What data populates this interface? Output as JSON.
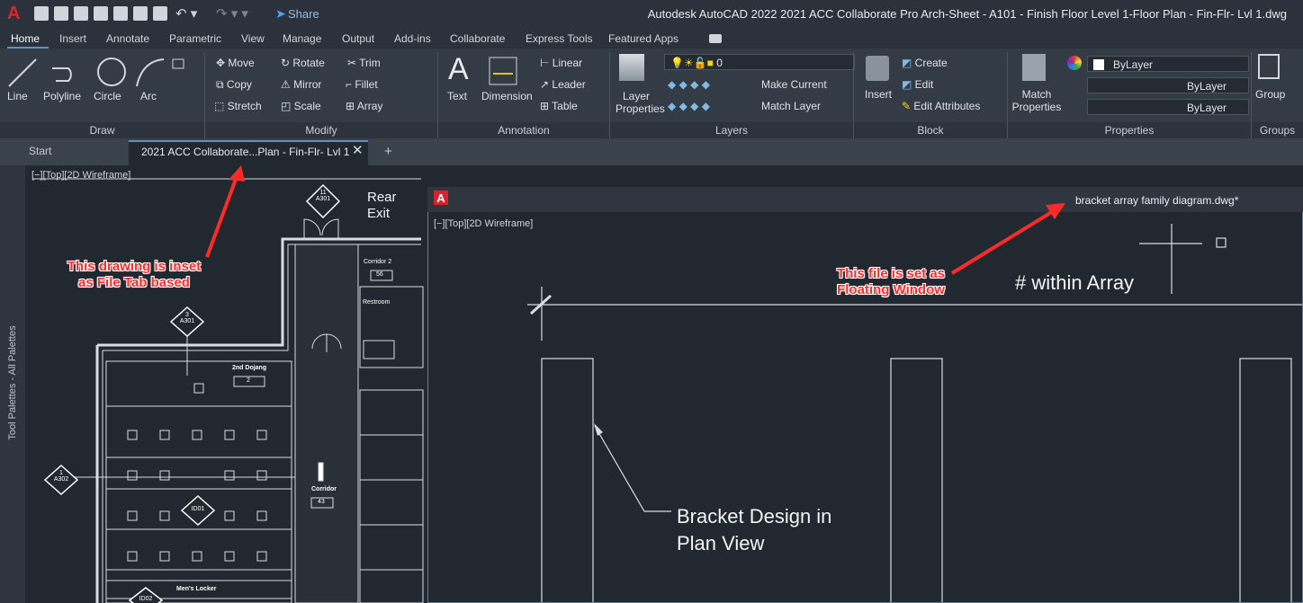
{
  "title_bar": {
    "app_logo": "A",
    "share_label": "Share",
    "title": "Autodesk AutoCAD 2022   2021 ACC Collaborate Pro Arch-Sheet - A101 - Finish Floor Level 1-Floor Plan - Fin-Flr- Lvl 1.dwg"
  },
  "ribbon_tabs": [
    "Home",
    "Insert",
    "Annotate",
    "Parametric",
    "View",
    "Manage",
    "Output",
    "Add-ins",
    "Collaborate",
    "Express Tools",
    "Featured Apps"
  ],
  "ribbon": {
    "draw": {
      "title": "Draw",
      "items": [
        "Line",
        "Polyline",
        "Circle",
        "Arc"
      ]
    },
    "modify": {
      "title": "Modify",
      "items": [
        "Move",
        "Rotate",
        "Trim",
        "Copy",
        "Mirror",
        "Fillet",
        "Stretch",
        "Scale",
        "Array"
      ]
    },
    "annotation": {
      "title": "Annotation",
      "items": [
        "Text",
        "Dimension",
        "Linear",
        "Leader",
        "Table"
      ]
    },
    "layers": {
      "title": "Layers",
      "layer_properties": "Layer Properties",
      "current_layer": "0",
      "make_current": "Make Current",
      "match_layer": "Match Layer"
    },
    "block": {
      "title": "Block",
      "insert": "Insert",
      "create": "Create",
      "edit": "Edit",
      "edit_attributes": "Edit Attributes"
    },
    "properties": {
      "title": "Properties",
      "match_properties": "Match Properties",
      "color": "ByLayer",
      "linetype": "ByLayer",
      "lineweight": "ByLayer"
    },
    "groups": {
      "title": "Groups",
      "group": "Group"
    }
  },
  "file_tabs": {
    "start": "Start",
    "active_doc": "2021 ACC Collaborate...Plan - Fin-Flr- Lvl 1"
  },
  "palette_label": "Tool Palettes - All Palettes",
  "main_viewport_label": "[−][Top][2D Wireframe]",
  "floor_plan": {
    "rear_exit": [
      "Rear",
      "Exit"
    ],
    "rooms": [
      {
        "name": "Corridor 2",
        "number": "56"
      },
      {
        "name": "Restroom",
        "number": ""
      },
      {
        "name": "2nd Dojang",
        "number": "2"
      },
      {
        "name": "Corridor",
        "number": "43"
      },
      {
        "name": "Men's Locker",
        "number": ""
      }
    ],
    "callouts": [
      {
        "top": "11",
        "bottom": "A301"
      },
      {
        "top": "3",
        "bottom": "A301"
      },
      {
        "top": "1",
        "bottom": "A302"
      },
      {
        "top": "ID01",
        "bottom": ""
      },
      {
        "top": "ID02",
        "bottom": ""
      }
    ]
  },
  "annotations": {
    "file_tab_note": [
      "This drawing is inset",
      "as File Tab based"
    ],
    "floating_note": [
      "This file is set as",
      "Floating Window"
    ]
  },
  "floating_window": {
    "logo": "A",
    "filename": "bracket array family diagram.dwg*",
    "viewport_label": "[−][Top][2D Wireframe]",
    "within_array_text": "# within Array",
    "bracket_text": [
      "Bracket Design in",
      "Plan View"
    ]
  },
  "colors": {
    "cad_bg": "#212830",
    "ribbon_bg": "#333b45",
    "annotation_red": "#ff2a2a",
    "logo_red": "#e0242c",
    "tab_accent": "#6a8fb3"
  }
}
